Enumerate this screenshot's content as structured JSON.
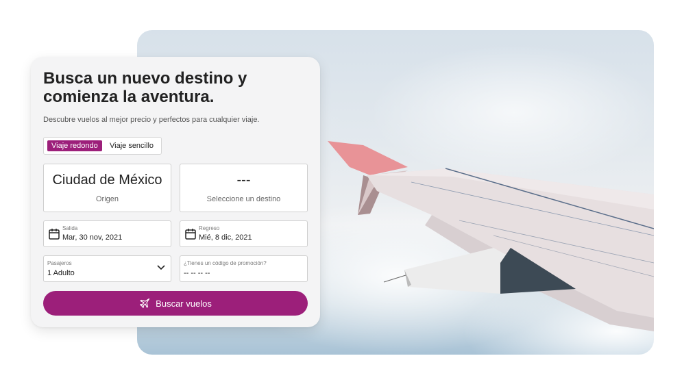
{
  "hero": {
    "image": "airplane-wing-over-clouds"
  },
  "search_card": {
    "title": "Busca un nuevo destino y comienza la aventura.",
    "subtitle": "Descubre vuelos al mejor precio y perfectos para cualquier viaje.",
    "trip_type": {
      "options": [
        "Viaje redondo",
        "Viaje sencillo"
      ],
      "selected": "Viaje redondo"
    },
    "origin": {
      "city": "Ciudad de México",
      "label": "Origen"
    },
    "destination": {
      "city": "---",
      "label": "Seleccione un destino"
    },
    "departure": {
      "label": "Salida",
      "value": "Mar, 30 nov, 2021",
      "icon": "calendar-icon"
    },
    "return": {
      "label": "Regreso",
      "value": "Mié, 8 dic, 2021",
      "icon": "calendar-icon"
    },
    "passengers": {
      "label": "Pasajeros",
      "value": "1 Adulto",
      "icon": "chevron-down-icon"
    },
    "promo": {
      "label": "¿Tienes un código de promoción?",
      "value": "-- -- -- --"
    },
    "search_button": {
      "label": "Buscar vuelos",
      "icon": "airplane-icon"
    }
  },
  "colors": {
    "accent": "#9c1f7a",
    "card_bg": "#f4f4f5"
  }
}
